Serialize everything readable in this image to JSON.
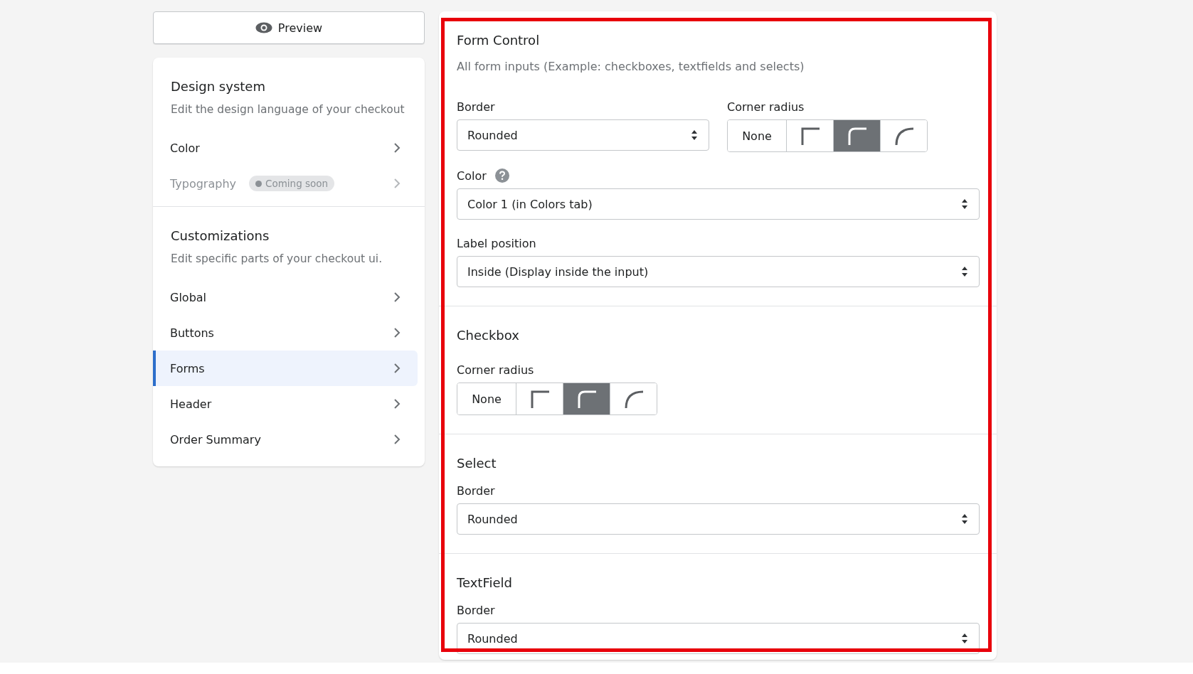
{
  "preview_button": {
    "label": "Preview"
  },
  "sidebar": {
    "sections": [
      {
        "title": "Design system",
        "subtitle": "Edit the design language of your checkout",
        "items": [
          {
            "label": "Color",
            "selected": false,
            "disabled": false
          },
          {
            "label": "Typography",
            "selected": false,
            "disabled": true,
            "badge": "Coming soon"
          }
        ]
      },
      {
        "title": "Customizations",
        "subtitle": "Edit specific parts of your checkout ui.",
        "items": [
          {
            "label": "Global",
            "selected": false,
            "disabled": false
          },
          {
            "label": "Buttons",
            "selected": false,
            "disabled": false
          },
          {
            "label": "Forms",
            "selected": true,
            "disabled": false
          },
          {
            "label": "Header",
            "selected": false,
            "disabled": false
          },
          {
            "label": "Order Summary",
            "selected": false,
            "disabled": false
          }
        ]
      }
    ]
  },
  "settings": {
    "highlighted": true,
    "sections": [
      {
        "title": "Form Control",
        "subtitle": "All form inputs (Example: checkboxes, textfields and selects)",
        "rows": [
          [
            {
              "label": "Border",
              "kind": "select",
              "value": "Rounded"
            },
            {
              "label": "Corner radius",
              "kind": "segmented",
              "options": [
                {
                  "kind": "text",
                  "label": "None",
                  "selected": false
                },
                {
                  "kind": "square",
                  "selected": false
                },
                {
                  "kind": "rounded",
                  "selected": true
                },
                {
                  "kind": "round",
                  "selected": false
                }
              ]
            }
          ],
          [
            {
              "label": "Color",
              "kind": "select",
              "value": "Color 1 (in Colors tab)",
              "help": true
            }
          ],
          [
            {
              "label": "Label position",
              "kind": "select",
              "value": "Inside (Display inside the input)"
            }
          ]
        ]
      },
      {
        "title": "Checkbox",
        "rows": [
          [
            {
              "label": "Corner radius",
              "kind": "segmented",
              "options": [
                {
                  "kind": "text",
                  "label": "None",
                  "selected": false
                },
                {
                  "kind": "square",
                  "selected": false
                },
                {
                  "kind": "rounded",
                  "selected": true
                },
                {
                  "kind": "round",
                  "selected": false
                }
              ]
            }
          ]
        ]
      },
      {
        "title": "Select",
        "rows": [
          [
            {
              "label": "Border",
              "kind": "select",
              "value": "Rounded"
            }
          ]
        ]
      },
      {
        "title": "TextField",
        "rows": [
          [
            {
              "label": "Border",
              "kind": "select",
              "value": "Rounded"
            }
          ]
        ]
      }
    ]
  }
}
